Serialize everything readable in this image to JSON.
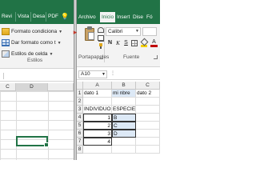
{
  "left_window": {
    "tabs": [
      "Revi",
      "Vista",
      "Desa",
      "PDF"
    ],
    "ribbon": {
      "conditional_format": "Formato condiciona",
      "format_as_table": "Dar formato como t",
      "cell_styles": "Estilos de celda",
      "group_label": "Estilos"
    },
    "column_headers": [
      "C",
      "D"
    ]
  },
  "right_window": {
    "tabs": [
      "Archivo",
      "Inicio",
      "Insert",
      "Dise",
      "Fó"
    ],
    "active_tab": "Inicio",
    "ribbon": {
      "paste_group_label": "Portapapeles",
      "font_name": "Calibri",
      "bold": "N",
      "italic": "K",
      "underline": "S",
      "font_color_letter": "A",
      "font_group_label": "Fuente"
    },
    "name_box": "A10",
    "column_headers": [
      "A",
      "B",
      "C"
    ],
    "rows": [
      {
        "num": "1",
        "a": "dato 1",
        "b": "mi nbre",
        "c": "dato 2"
      },
      {
        "num": "2",
        "a": "",
        "b": "",
        "c": ""
      },
      {
        "num": "3",
        "a": "INDIVIDUO",
        "b": "ESPECIE",
        "c": ""
      },
      {
        "num": "4",
        "a": "1",
        "b": "B",
        "c": ""
      },
      {
        "num": "5",
        "a": "2",
        "b": "C",
        "c": ""
      },
      {
        "num": "6",
        "a": "3",
        "b": "D",
        "c": ""
      },
      {
        "num": "7",
        "a": "4",
        "b": "",
        "c": ""
      },
      {
        "num": "8",
        "a": "",
        "b": "",
        "c": ""
      }
    ]
  }
}
